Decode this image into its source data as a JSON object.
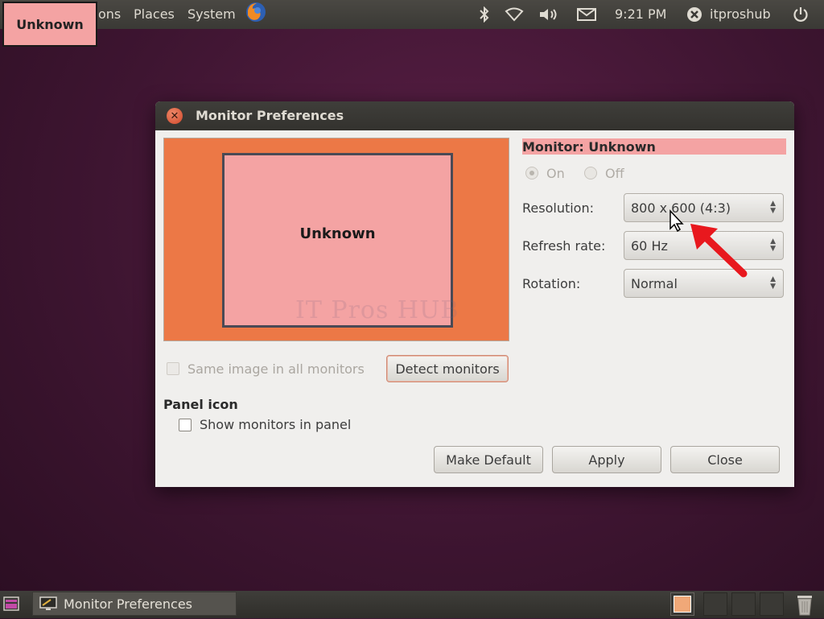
{
  "overlay": {
    "monitor_label": "Unknown"
  },
  "top_panel": {
    "menus": [
      "ons",
      "Places",
      "System"
    ],
    "time": "9:21 PM",
    "user": "itproshub",
    "icons": [
      "firefox-icon",
      "bluetooth-icon",
      "wifi-icon",
      "volume-icon",
      "mail-icon",
      "user-x-icon",
      "power-icon"
    ]
  },
  "window": {
    "title": "Monitor Preferences",
    "monitor_preview_label": "Unknown",
    "monitor_heading": "Monitor: Unknown",
    "power": {
      "on_label": "On",
      "off_label": "Off",
      "selected": "On"
    },
    "resolution": {
      "label": "Resolution:",
      "value": "800 x 600 (4:3)"
    },
    "refresh_rate": {
      "label": "Refresh rate:",
      "value": "60 Hz"
    },
    "rotation": {
      "label": "Rotation:",
      "value": "Normal"
    },
    "same_image_label": "Same image in all monitors",
    "detect_button": "Detect monitors",
    "panel_icon_heading": "Panel icon",
    "show_in_panel_label": "Show monitors in panel",
    "buttons": {
      "make_default": "Make Default",
      "apply": "Apply",
      "close": "Close"
    }
  },
  "watermark": "IT Pros HUB",
  "bottom_panel": {
    "taskbar_item": "Monitor Preferences"
  },
  "colors": {
    "accent_orange": "#ec7846",
    "highlight_pink": "#f4a3a3",
    "arrow_red": "#e8181e"
  }
}
